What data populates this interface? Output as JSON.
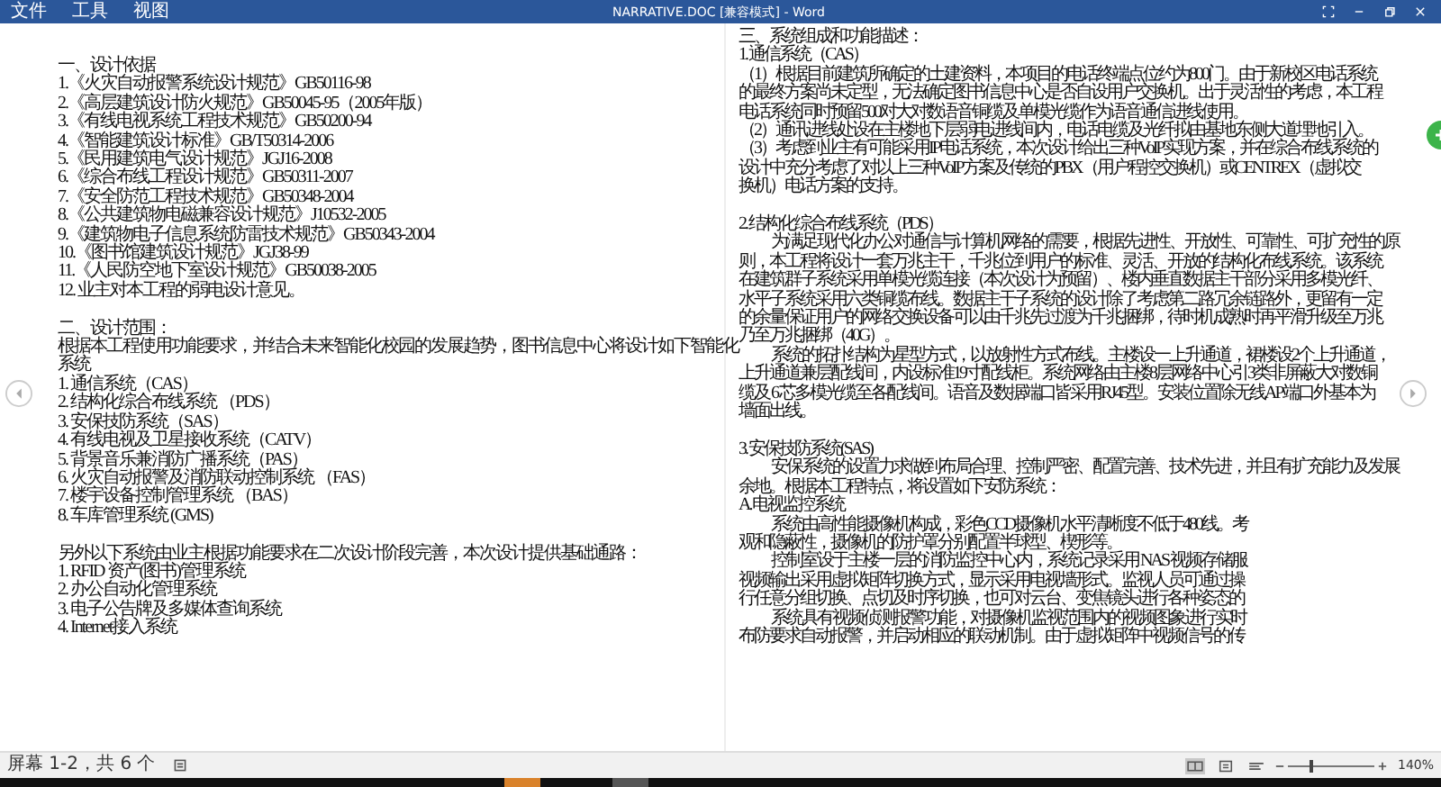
{
  "window": {
    "title": "NARRATIVE.DOC [兼容模式] - Word"
  },
  "menu": [
    "文件",
    "工具",
    "视图"
  ],
  "pages": [
    {
      "lines": [
        {
          "kind": "line",
          "text": "一、设计依据"
        },
        {
          "kind": "line",
          "text": "1.《火灾自动报警系统设计规范》GB50116-98"
        },
        {
          "kind": "line",
          "text": "2.《高层建筑设计防火规范》GB50045-95（2005年版）"
        },
        {
          "kind": "line",
          "text": "3.《有线电视系统工程技术规范》GB50200-94"
        },
        {
          "kind": "line",
          "text": "4.《智能建筑设计标准》GB/T50314-2006"
        },
        {
          "kind": "line",
          "text": "5.《民用建筑电气设计规范》JGJ16-2008"
        },
        {
          "kind": "line",
          "text": "6.《综合布线工程设计规范》GB50311-2007"
        },
        {
          "kind": "line",
          "text": "7.《安全防范工程技术规范》GB50348-2004"
        },
        {
          "kind": "line",
          "text": "8.《公共建筑物电磁兼容设计规范》J10532-2005"
        },
        {
          "kind": "line",
          "text": "9.《建筑物电子信息系统防雷技术规范》GB50343-2004"
        },
        {
          "kind": "line",
          "text": "10.《图书馆建筑设计规范》JGJ38-99"
        },
        {
          "kind": "line",
          "text": "11.《人民防空地下室设计规范》GB50038-2005"
        },
        {
          "kind": "line",
          "text": "12. 业主对本工程的弱电设计意见。"
        },
        {
          "kind": "blank"
        },
        {
          "kind": "line",
          "text": "二、设计范围："
        },
        {
          "kind": "line",
          "text": "根据本工程使用功能要求，并结合未来智能化校园的发展趋势，图书信息中心将设计如下智能化"
        },
        {
          "kind": "line",
          "text": "系统"
        },
        {
          "kind": "line",
          "text": "1.  通信系统（CAS）"
        },
        {
          "kind": "line",
          "text": "2. 结构化综合布线系统 （PDS）"
        },
        {
          "kind": "line",
          "text": "3. 安保技防系统（SAS）"
        },
        {
          "kind": "line",
          "text": "4. 有线电视及卫星接收系统（CATV）"
        },
        {
          "kind": "line",
          "text": "5. 背景音乐兼消防广播系统（PAS）"
        },
        {
          "kind": "line",
          "text": "6. 火灾自动报警及消防联动控制系统 （FAS）"
        },
        {
          "kind": "line",
          "text": "7. 楼宇设备控制管理系统 （BAS）"
        },
        {
          "kind": "line",
          "text": "8. 车库管理系统 (GMS)"
        },
        {
          "kind": "blank"
        },
        {
          "kind": "line",
          "text": "另外以下系统由业主根据功能要求在二次设计阶段完善，本次设计提供基础通路："
        },
        {
          "kind": "line",
          "text": "1. RFID 资产(图书)管理系统"
        },
        {
          "kind": "line",
          "text": "2. 办公自动化管理系统"
        },
        {
          "kind": "line",
          "text": "3. 电子公告牌及多媒体查询系统"
        },
        {
          "kind": "line",
          "text": "4. Internet接入系统"
        }
      ]
    },
    {
      "lines": [
        {
          "kind": "line",
          "text": "三、系统组成和功能描述："
        },
        {
          "kind": "line",
          "text": "1. 通信系统（CAS）"
        },
        {
          "kind": "line",
          "text": "（1）根据目前建筑所确定的土建资料，本项目的电话终端点位约为800门。由于新校区电话系统"
        },
        {
          "kind": "line",
          "text": "的最终方案尚未定型，无法确定图书信息中心是否自设用户交换机。出于灵活性的考虑，本工程"
        },
        {
          "kind": "line",
          "text": "电话系统同时预留500对大对数语音铜缆及单模光缆作为语音通信进线使用。"
        },
        {
          "kind": "line",
          "text": "（2）通讯进线处设在主楼地下层弱电进线间内，电话电缆及光纤拟由基地东侧大道埋地引入。"
        },
        {
          "kind": "line",
          "text": "（3）考虑到业主有可能采用IP电话系统，本次设计给出三种VoIP实现方案，并在综合布线系统的"
        },
        {
          "kind": "line",
          "text": "设计中充分考虑了对以上三种VoIP方案及传统的PBX（用户程控交换机）或CENTREX（虚拟交"
        },
        {
          "kind": "line",
          "text": "换机）电话方案的支持。"
        },
        {
          "kind": "blank"
        },
        {
          "kind": "line",
          "text": "2. 结构化综合布线系统（PDS）"
        },
        {
          "kind": "indent",
          "text": "为满足现代化办公对通信与计算机网络的需要，根据先进性、开放性、可靠性、可扩充性的原"
        },
        {
          "kind": "line",
          "text": "则，本工程将设计一套万兆主干，千兆位到用户的标准、灵活、开放的结构化布线系统。该系统"
        },
        {
          "kind": "line",
          "text": "在建筑群子系统采用单模光缆连接（本次设计为预留）、楼内垂直数据主干部分采用多模光纤、"
        },
        {
          "kind": "line",
          "text": "水平子系统采用六类铜缆布线。数据主干子系统的设计除了考虑第二路冗余链路外，更留有一定"
        },
        {
          "kind": "line",
          "text": "的余量保证用户的网络交换设备可以由千兆先过渡为千兆捆绑，待时机成熟时再平滑升级至万兆"
        },
        {
          "kind": "line",
          "text": "乃至万兆捆绑（40G）。"
        },
        {
          "kind": "indent",
          "text": "系统的拓扑结构为星型方式，以放射性方式布线。主楼设一上升通道，裙楼设2个上升通道，"
        },
        {
          "kind": "line",
          "text": "上升通道兼层配线间，内设标准19寸配线柜。系统网络由主楼8层网络中心引3类非屏蔽大对数铜"
        },
        {
          "kind": "line",
          "text": "缆及 6 芯多模光缆至各配线间。语音及数据端口皆采用RJ45型。安装位置除无线AP端口外基本为"
        },
        {
          "kind": "line",
          "text": "墙面出线。"
        },
        {
          "kind": "blank"
        },
        {
          "kind": "line",
          "text": "3. 安保技防系统(SAS)"
        },
        {
          "kind": "indent",
          "text": "安保系统的设置力求做到布局合理、控制严密、配置完善、技术先进，并且有扩充能力及发展"
        },
        {
          "kind": "line",
          "text": "余地。根据本工程特点，将设置如下安防系统："
        },
        {
          "kind": "line",
          "text": "A. 电视监控系统"
        },
        {
          "kind": "indent",
          "text": "系统由高性能摄像机构成，彩色CCD摄像机水平清晰度不低于480线。考"
        },
        {
          "kind": "line",
          "text": "观和隐蔽性，摄像机的防护罩分别配置半球型、楔形等。"
        },
        {
          "kind": "indent",
          "text": "控制室设于主楼一层的消防监控中心内，系统记录采用 NAS 视频存储服"
        },
        {
          "kind": "line",
          "text": "视频输出采用虚拟矩阵切换方式，显示采用电视墙形式。监视人员可通过操"
        },
        {
          "kind": "line",
          "text": "行任意分组切换、点切及时序切换，也可对云台、变焦镜头进行各种姿态的"
        },
        {
          "kind": "indent",
          "text": "系统具有视频侦测报警功能，对摄像机监视范围内的视频图象进行实时"
        },
        {
          "kind": "line",
          "text": "布防要求自动报警，并启动相应的联动机制。由于虚拟矩阵中视频信号的传"
        }
      ]
    }
  ],
  "status_bar": {
    "page_info": "屏幕 1-2，共 6 个",
    "zoom": "140%",
    "zoom_slider": {
      "level": 0.27
    }
  }
}
